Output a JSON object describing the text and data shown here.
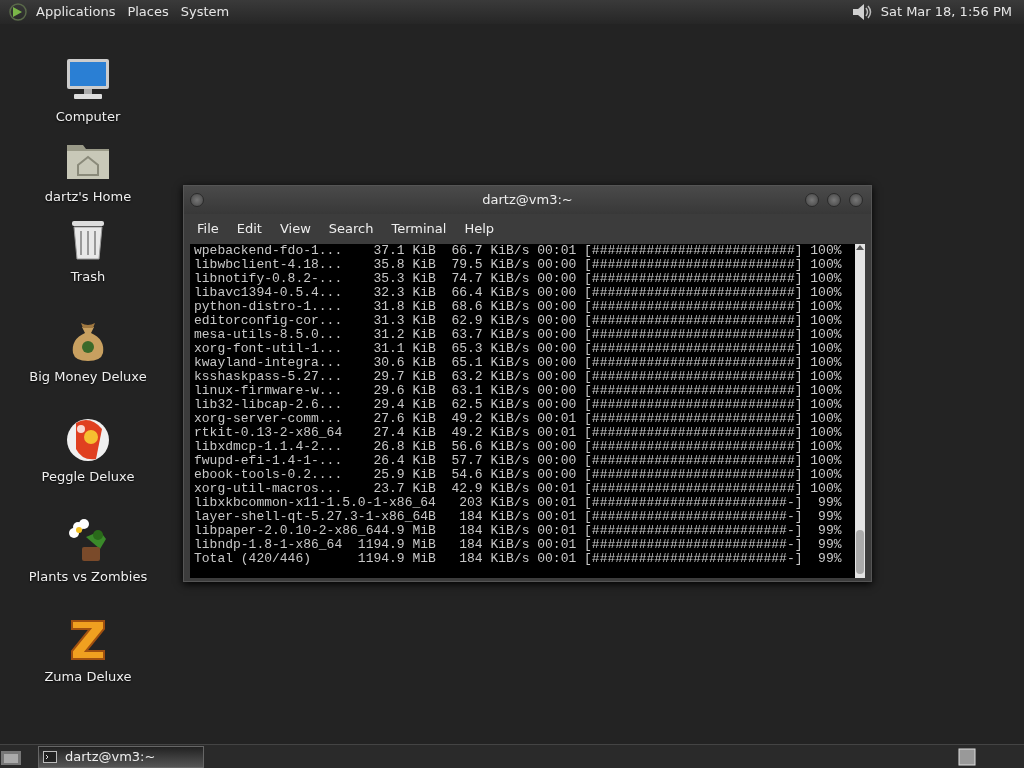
{
  "top_panel": {
    "menus": [
      "Applications",
      "Places",
      "System"
    ],
    "clock": "Sat Mar 18, 1:56 PM"
  },
  "desktop_icons": [
    {
      "kind": "computer",
      "label": "Computer"
    },
    {
      "kind": "home",
      "label": "dartz's Home"
    },
    {
      "kind": "trash",
      "label": "Trash"
    },
    {
      "kind": "moneybag",
      "label": "Big Money Deluxe"
    },
    {
      "kind": "ball",
      "label": "Peggle Deluxe"
    },
    {
      "kind": "flower",
      "label": "Plants vs Zombies"
    },
    {
      "kind": "block",
      "label": "Zuma Deluxe"
    }
  ],
  "terminal": {
    "title": "dartz@vm3:~",
    "menu": [
      "File",
      "Edit",
      "View",
      "Search",
      "Terminal",
      "Help"
    ],
    "lines": [
      "wpebackend-fdo-1...    37.1 KiB  66.7 KiB/s 00:01 [##########################] 100%",
      "libwbclient-4.18...    35.8 KiB  79.5 KiB/s 00:00 [##########################] 100%",
      "libnotify-0.8.2-...    35.3 KiB  74.7 KiB/s 00:00 [##########################] 100%",
      "libavc1394-0.5.4...    32.3 KiB  66.4 KiB/s 00:00 [##########################] 100%",
      "python-distro-1....    31.8 KiB  68.6 KiB/s 00:00 [##########################] 100%",
      "editorconfig-cor...    31.3 KiB  62.9 KiB/s 00:00 [##########################] 100%",
      "mesa-utils-8.5.0...    31.2 KiB  63.7 KiB/s 00:00 [##########################] 100%",
      "xorg-font-util-1...    31.1 KiB  65.3 KiB/s 00:00 [##########################] 100%",
      "kwayland-integra...    30.6 KiB  65.1 KiB/s 00:00 [##########################] 100%",
      "ksshaskpass-5.27...    29.7 KiB  63.2 KiB/s 00:00 [##########################] 100%",
      "linux-firmware-w...    29.6 KiB  63.1 KiB/s 00:00 [##########################] 100%",
      "lib32-libcap-2.6...    29.4 KiB  62.5 KiB/s 00:00 [##########################] 100%",
      "xorg-server-comm...    27.6 KiB  49.2 KiB/s 00:01 [##########################] 100%",
      "rtkit-0.13-2-x86_64    27.4 KiB  49.2 KiB/s 00:01 [##########################] 100%",
      "libxdmcp-1.1.4-2...    26.8 KiB  56.6 KiB/s 00:00 [##########################] 100%",
      "fwupd-efi-1.4-1-...    26.4 KiB  57.7 KiB/s 00:00 [##########################] 100%",
      "ebook-tools-0.2....    25.9 KiB  54.6 KiB/s 00:00 [##########################] 100%",
      "xorg-util-macros...    23.7 KiB  42.9 KiB/s 00:01 [##########################] 100%",
      "libxkbcommon-x11-1.5.0-1-x86_64   203 KiB/s 00:01 [#########################-]  99%",
      "layer-shell-qt-5.27.3-1-x86_64B   184 KiB/s 00:01 [#########################-]  99%",
      "libpaper-2.0.10-2-x86_644.9 MiB   184 KiB/s 00:01 [#########################-]  99%",
      "libndp-1.8-1-x86_64  1194.9 MiB   184 KiB/s 00:01 [#########################-]  99%",
      "Total (420/446)      1194.9 MiB   184 KiB/s 00:01 [#########################-]  99%"
    ]
  },
  "taskbar": {
    "tasks": [
      {
        "label": "dartz@vm3:~",
        "selected": true
      }
    ]
  }
}
